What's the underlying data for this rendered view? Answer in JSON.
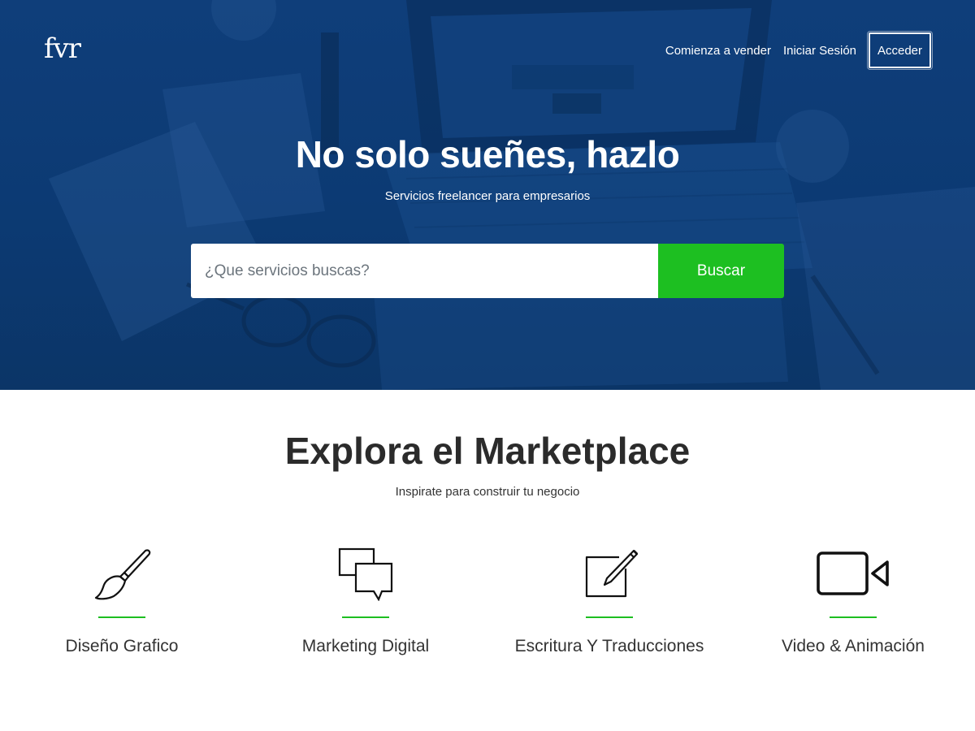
{
  "header": {
    "logo": "fvr",
    "nav": {
      "sell": "Comienza a vender",
      "login": "Iniciar Sesión",
      "signup": "Acceder"
    }
  },
  "hero": {
    "title": "No solo sueñes, hazlo",
    "subtitle": "Servicios freelancer para empresarios",
    "search": {
      "placeholder": "¿Que servicios buscas?",
      "button": "Buscar"
    }
  },
  "marketplace": {
    "title": "Explora el Marketplace",
    "subtitle": "Inspirate para construir tu negocio",
    "categories": [
      {
        "label": "Diseño Grafico",
        "icon": "paintbrush-icon"
      },
      {
        "label": "Marketing Digital",
        "icon": "chat-bubbles-icon"
      },
      {
        "label": "Escritura Y Traducciones",
        "icon": "edit-icon"
      },
      {
        "label": "Video & Animación",
        "icon": "video-camera-icon"
      }
    ]
  },
  "colors": {
    "hero_overlay": "#0c3a73",
    "accent_green": "#1dbf21",
    "text_dark": "#2b2b2b"
  }
}
